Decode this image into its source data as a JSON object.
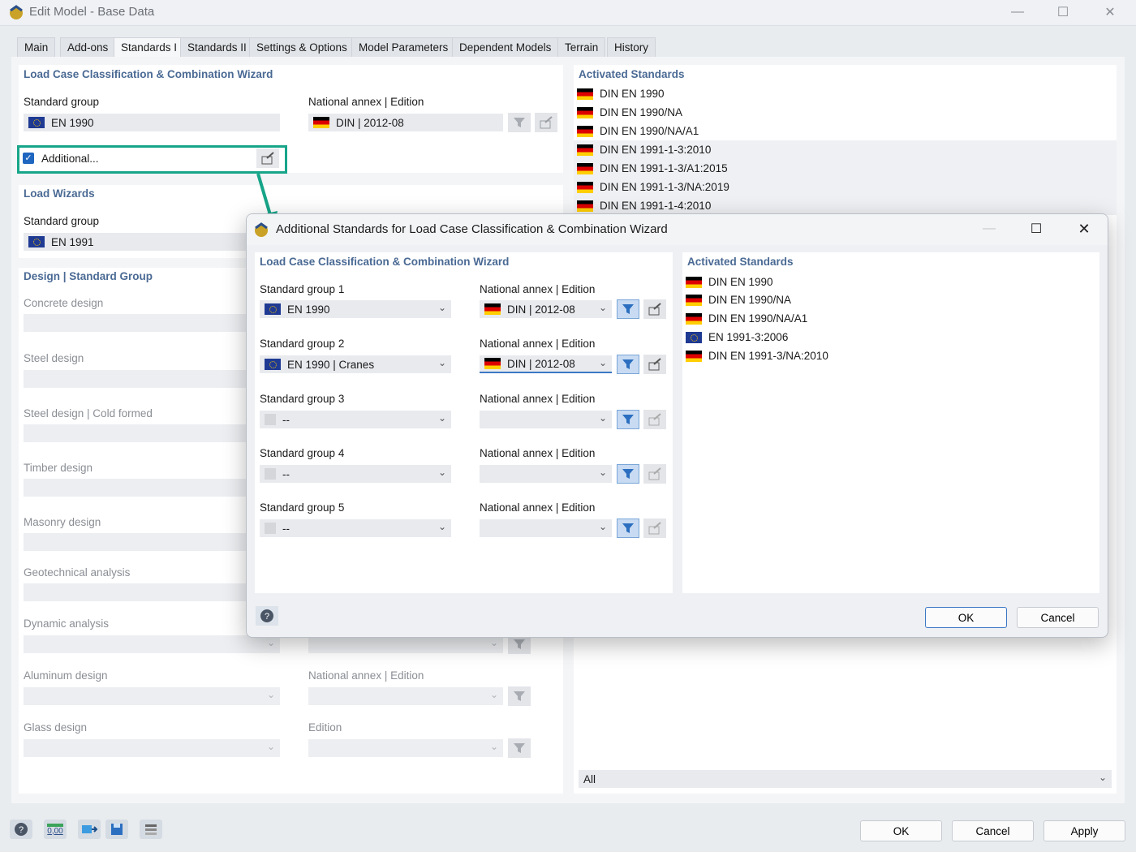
{
  "window": {
    "title": "Edit Model - Base Data"
  },
  "tabs": [
    "Main",
    "Add-ons",
    "Standards I",
    "Standards II",
    "Settings & Options",
    "Model Parameters",
    "Dependent Models",
    "Terrain",
    "History"
  ],
  "lcc": {
    "title": "Load Case Classification & Combination Wizard",
    "standard_group_label": "Standard group",
    "standard_group_value": "EN 1990",
    "annex_label": "National annex | Edition",
    "annex_value": "DIN | 2012-08",
    "additional_label": "Additional..."
  },
  "load_wizards": {
    "title": "Load Wizards",
    "standard_group_label": "Standard group",
    "standard_group_value": "EN 1991"
  },
  "design": {
    "title": "Design | Standard Group",
    "items": [
      "Concrete design",
      "Steel design",
      "Steel design | Cold formed",
      "Timber design",
      "Masonry design",
      "Geotechnical analysis",
      "Dynamic analysis",
      "Aluminum design",
      "Glass design"
    ],
    "aluminum_annex_label": "National annex | Edition",
    "glass_edition_label": "Edition"
  },
  "activated": {
    "title": "Activated Standards",
    "items": [
      "DIN EN 1990",
      "DIN EN 1990/NA",
      "DIN EN 1990/NA/A1",
      "DIN EN 1991-1-3:2010",
      "DIN EN 1991-1-3/A1:2015",
      "DIN EN 1991-1-3/NA:2019",
      "DIN EN 1991-1-4:2010"
    ],
    "filter_value": "All"
  },
  "dialog": {
    "title": "Additional Standards for Load Case Classification & Combination Wizard",
    "left_title": "Load Case Classification & Combination Wizard",
    "annex_label": "National annex | Edition",
    "groups": [
      {
        "label": "Standard group 1",
        "value": "EN 1990",
        "annex": "DIN | 2012-08"
      },
      {
        "label": "Standard group 2",
        "value": "EN 1990 | Cranes",
        "annex": "DIN | 2012-08"
      },
      {
        "label": "Standard group 3",
        "value": "--",
        "annex": ""
      },
      {
        "label": "Standard group 4",
        "value": "--",
        "annex": ""
      },
      {
        "label": "Standard group 5",
        "value": "--",
        "annex": ""
      }
    ],
    "right_title": "Activated Standards",
    "activated": [
      "DIN EN 1990",
      "DIN EN 1990/NA",
      "DIN EN 1990/NA/A1",
      "EN 1991-3:2006",
      "DIN EN 1991-3/NA:2010"
    ],
    "ok": "OK",
    "cancel": "Cancel"
  },
  "footer": {
    "ok": "OK",
    "cancel": "Cancel",
    "apply": "Apply",
    "decimal_label": "0,00"
  },
  "colors": {
    "section_title": "#4a6a94",
    "highlight": "#17a589",
    "accent_blue": "#3c78c4"
  }
}
